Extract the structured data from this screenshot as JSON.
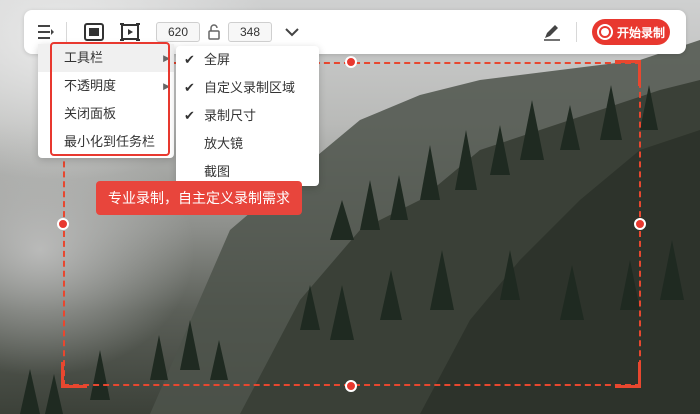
{
  "toolbar": {
    "width_value": "620",
    "height_value": "348",
    "record_label": "开始录制",
    "icons": [
      "menu-list-icon",
      "fullscreen-icon",
      "video-region-icon",
      "lock-icon",
      "chevron-down-icon",
      "pen-icon",
      "record-icon"
    ]
  },
  "menu": {
    "items": [
      {
        "label": "工具栏",
        "has_submenu": true
      },
      {
        "label": "不透明度",
        "has_submenu": true
      },
      {
        "label": "关闭面板",
        "has_submenu": false
      },
      {
        "label": "最小化到任务栏",
        "has_submenu": false
      }
    ]
  },
  "submenu": {
    "items": [
      {
        "label": "全屏",
        "checked": true
      },
      {
        "label": "自定义录制区域",
        "checked": true
      },
      {
        "label": "录制尺寸",
        "checked": true
      },
      {
        "label": "放大镜",
        "checked": false
      },
      {
        "label": "截图",
        "checked": false
      }
    ]
  },
  "tooltip": "专业录制，自主定义录制需求",
  "colors": {
    "accent": "#e8382f",
    "frame": "#e8472f"
  }
}
